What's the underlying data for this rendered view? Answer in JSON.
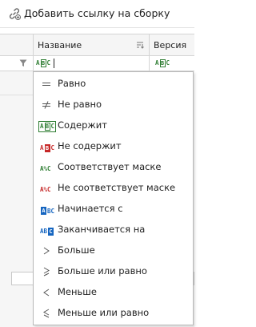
{
  "window": {
    "title": "Добавить ссылку на сборку"
  },
  "grid": {
    "columns": [
      {
        "label": "Название"
      },
      {
        "label": "Версия"
      }
    ],
    "filter_row": {
      "name_condition_glyph": "ABC",
      "version_condition_glyph": "ABC"
    }
  },
  "menu": {
    "items": [
      {
        "label": "Равно",
        "icon": "equals-icon"
      },
      {
        "label": "Не равно",
        "icon": "not-equals-icon"
      },
      {
        "label": "Содержит",
        "icon": "contains-icon",
        "selected": true
      },
      {
        "label": "Не содержит",
        "icon": "not-contains-icon"
      },
      {
        "label": "Соответствует маске",
        "icon": "like-icon"
      },
      {
        "label": "Не соответствует маске",
        "icon": "not-like-icon"
      },
      {
        "label": "Начинается с",
        "icon": "starts-with-icon"
      },
      {
        "label": "Заканчивается на",
        "icon": "ends-with-icon"
      },
      {
        "label": "Больше",
        "icon": "greater-icon"
      },
      {
        "label": "Больше или равно",
        "icon": "greater-or-equal-icon"
      },
      {
        "label": "Меньше",
        "icon": "less-icon"
      },
      {
        "label": "Меньше или равно",
        "icon": "less-or-equal-icon"
      }
    ]
  },
  "colors": {
    "contains_green": "#2e7d32",
    "not_contains_red": "#c62828",
    "starts_ends_blue": "#1565c0"
  }
}
